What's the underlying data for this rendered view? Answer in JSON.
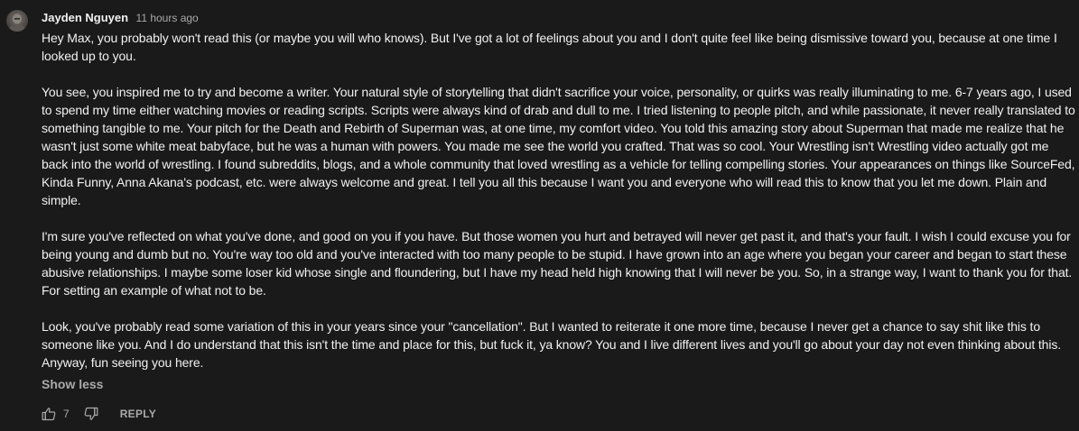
{
  "comment": {
    "author": "Jayden Nguyen",
    "timestamp": "11 hours ago",
    "avatar_icon": "avatar-icon",
    "paragraphs": [
      "Hey Max, you probably won't read this (or maybe you will who knows). But I've got a lot of feelings about you and I don't quite feel like being dismissive toward you, because at one time I looked up to you.",
      "You see, you inspired me to try and become a writer. Your natural style of storytelling that didn't sacrifice your voice, personality, or quirks was really illuminating to me. 6-7 years ago, I used to spend my time either watching movies or reading scripts. Scripts were always kind of drab and dull to me. I tried listening to people pitch, and while passionate, it never really translated to something tangible to me. Your pitch for the Death and Rebirth of Superman was, at one time, my comfort video. You told this amazing story about Superman that made me realize that he wasn't just some white meat babyface, but he was a human with powers. You made me see the world you crafted. That was so cool. Your Wrestling isn't Wrestling video actually got me back into the world of wrestling. I found subreddits, blogs, and a whole community that loved wrestling as a vehicle for telling compelling stories. Your appearances on things like SourceFed, Kinda Funny, Anna Akana's podcast, etc. were always welcome and great. I tell you all this because I want you and everyone who will read this to know that you let me down. Plain and simple.",
      "I'm sure you've reflected on what you've done, and good on you if you have. But those women you hurt and betrayed will never get past it, and that's your fault. I wish I could excuse you for being young and dumb but no. You're way too old and you've interacted with too many people to be stupid. I have grown into an age where you began your career and began to start these abusive relationships. I maybe some loser kid whose single and floundering, but I have my head held high knowing that I will never be you. So, in a strange way, I want to thank you for that. For setting an example of what not to be.",
      "Look, you've probably read some variation of this in your years since your \"cancellation\". But I wanted to reiterate it one more time, because I never get a chance to say shit like this to someone like you. And I do understand that this isn't the time and place for this, but fuck it, ya know? You and I live different lives and you'll go about your day not even thinking about this. Anyway, fun seeing you here."
    ],
    "show_less_label": "Show less",
    "like_count": "7",
    "reply_label": "REPLY",
    "like_icon": "thumbs-up-icon",
    "dislike_icon": "thumbs-down-icon"
  },
  "colors": {
    "background": "#1a1a1a",
    "text_primary": "#f1f1f1",
    "text_secondary": "#aaaaaa"
  }
}
